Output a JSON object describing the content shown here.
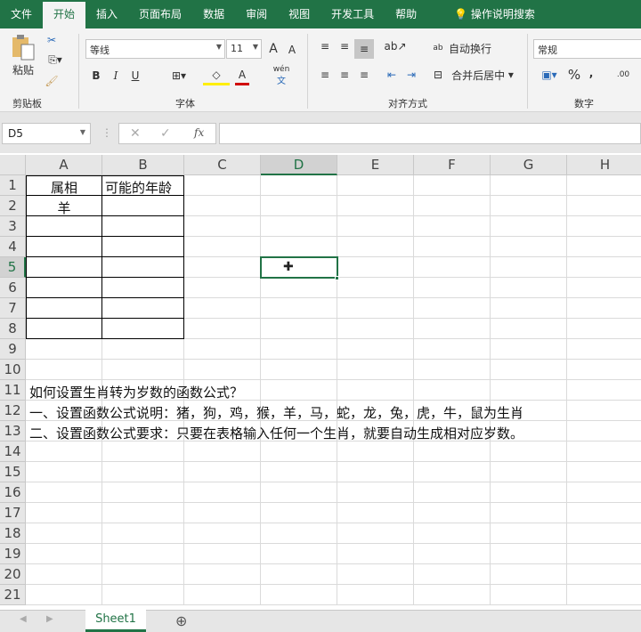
{
  "menu": [
    "文件",
    "开始",
    "插入",
    "页面布局",
    "数据",
    "审阅",
    "视图",
    "开发工具",
    "帮助",
    "操作说明搜索"
  ],
  "ribbon": {
    "clipboard": {
      "paste": "粘贴",
      "label": "剪贴板"
    },
    "font": {
      "name": "等线",
      "size": "11",
      "label": "字体",
      "phonetic": "wén",
      "phonetic2": "文",
      "bold": "B",
      "italic": "I",
      "underline": "U",
      "grow": "A",
      "shrink": "A"
    },
    "align": {
      "wrap": "自动换行",
      "merge": "合并后居中",
      "label": "对齐方式"
    },
    "number": {
      "format": "常规",
      "percent": "%",
      "comma": ",",
      "label": "数字",
      "dec": ".00"
    }
  },
  "namebox": "D5",
  "formula": "",
  "columns": [
    "A",
    "B",
    "C",
    "D",
    "E",
    "F",
    "G",
    "H"
  ],
  "rows": [
    "1",
    "2",
    "3",
    "4",
    "5",
    "6",
    "7",
    "8",
    "9",
    "10",
    "11",
    "12",
    "13",
    "14",
    "15",
    "16",
    "17",
    "18",
    "19",
    "20",
    "21"
  ],
  "cells": {
    "A1": "属相",
    "B1": "可能的年龄",
    "A2": "羊",
    "A11": "如何设置生肖转为岁数的函数公式？",
    "A12": "一、设置函数公式说明：猪，狗，鸡，猴，羊，马，蛇，龙，兔，虎，牛，鼠为生肖",
    "A13": "二、设置函数公式要求：只要在表格输入任何一个生肖，就要自动生成相对应岁数。"
  },
  "selected_cell": "D5",
  "sheet_tabs": [
    "Sheet1"
  ],
  "colors": {
    "accent": "#217346"
  }
}
